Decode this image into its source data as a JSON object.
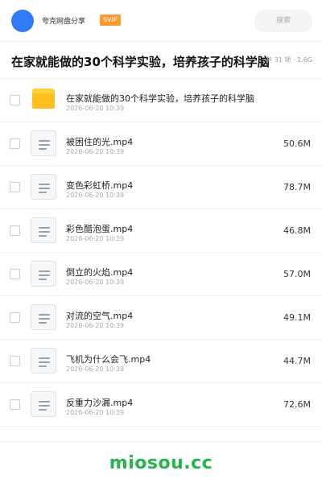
{
  "header": {
    "user_name": "夸克网盘分享",
    "badge": "SVIP",
    "search_placeholder": "搜索",
    "avatar_color": "#2f7cf6"
  },
  "title_row": {
    "title": "在家就能做的30个科学实验，培养孩子的科学脑",
    "count_info": "共 31 项 · 1.6G"
  },
  "items": [
    {
      "type": "folder",
      "name": "在家就能做的30个科学实验，培养孩子的科学脑",
      "date": "2026-06-20 10:39",
      "size": "",
      "icon": "folder-icon"
    },
    {
      "type": "file",
      "name": "被困住的光.mp4",
      "date": "2026-06-20 10:39",
      "size": "50.6M",
      "icon": "file-icon"
    },
    {
      "type": "file",
      "name": "变色彩虹桥.mp4",
      "date": "2026-06-20 10:39",
      "size": "78.7M",
      "icon": "file-icon"
    },
    {
      "type": "file",
      "name": "彩色醋泡蛋.mp4",
      "date": "2026-06-20 10:39",
      "size": "46.8M",
      "icon": "file-icon"
    },
    {
      "type": "file",
      "name": "倒立的火焰.mp4",
      "date": "2026-06-20 10:39",
      "size": "57.0M",
      "icon": "file-icon"
    },
    {
      "type": "file",
      "name": "对流的空气.mp4",
      "date": "2026-06-20 10:39",
      "size": "49.1M",
      "icon": "file-icon"
    },
    {
      "type": "file",
      "name": "飞机为什么会飞.mp4",
      "date": "2026-06-20 10:39",
      "size": "44.7M",
      "icon": "file-icon"
    },
    {
      "type": "file",
      "name": "反重力沙漏.mp4",
      "date": "2026-06-20 10:39",
      "size": "72.6M",
      "icon": "file-icon"
    }
  ],
  "footer": {
    "watermark": "miosou.cc",
    "watermark_color": "#26b34a"
  }
}
